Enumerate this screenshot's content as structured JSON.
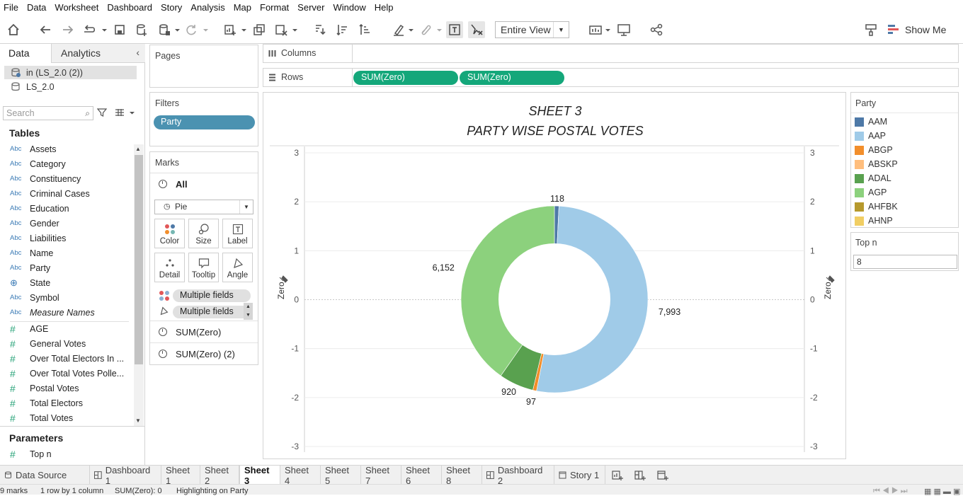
{
  "menu": [
    "File",
    "Data",
    "Worksheet",
    "Dashboard",
    "Story",
    "Analysis",
    "Map",
    "Format",
    "Server",
    "Window",
    "Help"
  ],
  "toolbar": {
    "view_mode": "Entire View",
    "show_me": "Show Me"
  },
  "left_panel": {
    "tabs": {
      "data": "Data",
      "analytics": "Analytics"
    },
    "data_sources": [
      "in (LS_2.0 (2))",
      "LS_2.0"
    ],
    "search_placeholder": "Search",
    "tables_heading": "Tables",
    "dimensions": [
      "Assets",
      "Category",
      "Constituency",
      "Criminal Cases",
      "Education",
      "Gender",
      "Liabilities",
      "Name",
      "Party",
      "State",
      "Symbol",
      "Measure Names"
    ],
    "dimension_type": "Abc",
    "measures": [
      "AGE",
      "General Votes",
      "Over Total Electors  In ...",
      "Over Total Votes Polle...",
      "Postal Votes",
      "Total Electors",
      "Total Votes"
    ],
    "parameters_heading": "Parameters",
    "parameters": [
      "Top n"
    ]
  },
  "cards": {
    "pages": "Pages",
    "filters": "Filters",
    "filter_pill": "Party",
    "marks": "Marks",
    "marks_all": "All",
    "mark_type": "Pie",
    "buttons": [
      "Color",
      "Size",
      "Label",
      "Detail",
      "Tooltip",
      "Angle"
    ],
    "multi_pills": [
      "Multiple fields",
      "Multiple fields"
    ],
    "measure_rows": [
      "SUM(Zero)",
      "SUM(Zero) (2)"
    ]
  },
  "shelves": {
    "columns_label": "Columns",
    "rows_label": "Rows",
    "row_pills": [
      "SUM(Zero)",
      "SUM(Zero)"
    ]
  },
  "chart_data": {
    "type": "pie",
    "title": "SHEET 3",
    "subtitle": "PARTY  WISE  POSTAL VOTES",
    "donut": true,
    "slices": [
      {
        "name": "AAM",
        "value": 118,
        "label": "118",
        "color": "#4e79a7"
      },
      {
        "name": "AAP",
        "value": 7993,
        "label": "7,993",
        "color": "#a0cbe8"
      },
      {
        "name": "ABGP",
        "value": 97,
        "label": "97",
        "color": "#f28e2b"
      },
      {
        "name": "ADAL",
        "value": 920,
        "label": "920",
        "color": "#59a14f"
      },
      {
        "name": "AGP",
        "value": 6152,
        "label": "6,152",
        "color": "#8cd17d"
      }
    ],
    "axis_label": "Zero",
    "y_ticks": [
      "3",
      "2",
      "1",
      "0",
      "-1",
      "-2",
      "-3"
    ],
    "ylim": [
      -3,
      3
    ]
  },
  "legend": {
    "title": "Party",
    "items": [
      {
        "name": "AAM",
        "color": "#4e79a7"
      },
      {
        "name": "AAP",
        "color": "#a0cbe8"
      },
      {
        "name": "ABGP",
        "color": "#f28e2b"
      },
      {
        "name": "ABSKP",
        "color": "#ffbe7d"
      },
      {
        "name": "ADAL",
        "color": "#59a14f"
      },
      {
        "name": "AGP",
        "color": "#8cd17d"
      },
      {
        "name": "AHFBK",
        "color": "#b6992d"
      },
      {
        "name": "AHNP",
        "color": "#f1ce63"
      }
    ]
  },
  "parameter_control": {
    "title": "Top n",
    "value": "8"
  },
  "sheet_tabs": [
    "Data Source",
    "Dashboard 1",
    "Sheet 1",
    "Sheet 2",
    "Sheet 3",
    "Sheet 4",
    "Sheet 5",
    "Sheet 7",
    "Sheet 6",
    "Sheet 8",
    "Dashboard 2",
    "Story 1"
  ],
  "active_tab": "Sheet 3",
  "status": [
    "9 marks",
    "1 row by 1 column",
    "SUM(Zero): 0",
    "Highlighting on Party"
  ]
}
